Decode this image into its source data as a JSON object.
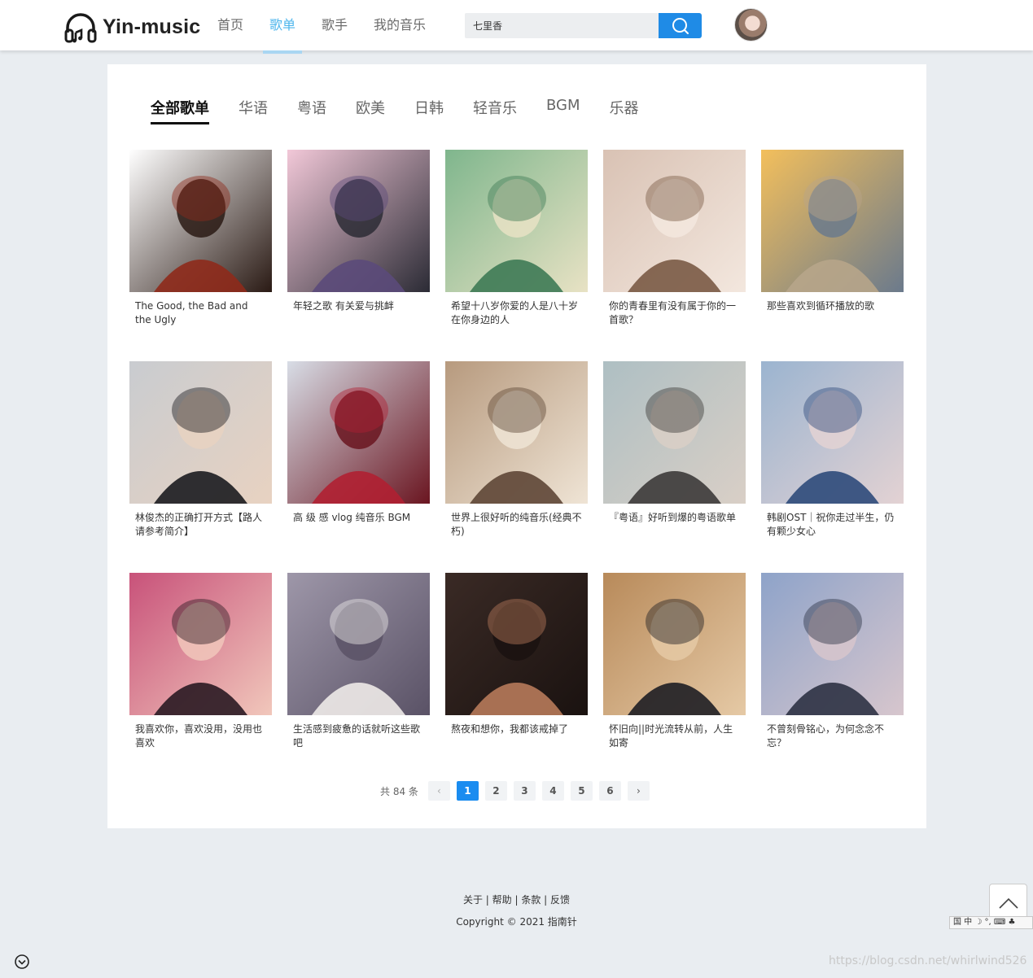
{
  "header": {
    "logo_text": "Yin-music",
    "nav": [
      "首页",
      "歌单",
      "歌手",
      "我的音乐"
    ],
    "active_nav": 1,
    "search_value": "七里香"
  },
  "tabs": [
    "全部歌单",
    "华语",
    "粤语",
    "欧美",
    "日韩",
    "轻音乐",
    "BGM",
    "乐器"
  ],
  "active_tab": 0,
  "playlists": [
    {
      "title": "The Good, the Bad and the Ugly",
      "palette": [
        "#ffffff",
        "#8e2a1b",
        "#2a1a14"
      ]
    },
    {
      "title": "年轻之歌 有关爱与挑衅",
      "palette": [
        "#f2c8d8",
        "#5b4a7a",
        "#2b2b35"
      ]
    },
    {
      "title": "希望十八岁你爱的人是八十岁在你身边的人",
      "palette": [
        "#7fb68d",
        "#3e7a55",
        "#e8e2c4"
      ]
    },
    {
      "title": "你的青春里有没有属于你的一首歌？",
      "palette": [
        "#d9c2b4",
        "#7a5a45",
        "#f3e7de"
      ]
    },
    {
      "title": "那些喜欢到循环播放的歌",
      "palette": [
        "#f3bf5c",
        "#b7a58a",
        "#6b7a8c"
      ]
    },
    {
      "title": "林俊杰的正确打开方式【路人请参考简介】",
      "palette": [
        "#c9ccd0",
        "#1b1b1f",
        "#e8d2c1"
      ]
    },
    {
      "title": "高 级 感 vlog 纯音乐 BGM",
      "palette": [
        "#d8dde6",
        "#b02032",
        "#6a1520"
      ]
    },
    {
      "title": "世界上很好听的纯音乐(经典不朽)",
      "palette": [
        "#b79a7e",
        "#5e4636",
        "#efe4d5"
      ]
    },
    {
      "title": "『粤语』好听到爆的粤语歌单",
      "palette": [
        "#aebfc3",
        "#3c3a38",
        "#d9cfc6"
      ]
    },
    {
      "title": "韩剧OST｜祝你走过半生，仍有颗少女心",
      "palette": [
        "#9bb4d0",
        "#2e4a7a",
        "#e3d2d3"
      ]
    },
    {
      "title": "我喜欢你，喜欢没用，没用也喜欢",
      "palette": [
        "#c8527a",
        "#2a1a22",
        "#f1c7bb"
      ]
    },
    {
      "title": "生活感到疲惫的话就听这些歌吧",
      "palette": [
        "#9e97a9",
        "#eeeae8",
        "#5a5266"
      ]
    },
    {
      "title": "熬夜和想你，我都该戒掉了",
      "palette": [
        "#3a2a25",
        "#b77a5a",
        "#1a1210"
      ]
    },
    {
      "title": "怀旧向||时光流转从前，人生如寄",
      "palette": [
        "#b88a5a",
        "#1e1e24",
        "#e5c9a5"
      ]
    },
    {
      "title": "不曾刻骨铭心，为何念念不忘？",
      "palette": [
        "#8ea3c9",
        "#2d3244",
        "#d7c6cd"
      ]
    }
  ],
  "pagination": {
    "total_label": "共 84 条",
    "pages": [
      "1",
      "2",
      "3",
      "4",
      "5",
      "6"
    ],
    "current": 1,
    "prev": "‹",
    "next": "›"
  },
  "footer": {
    "links": "关于 | 帮助 | 条款 | 反馈",
    "copyright": "Copyright © 2021 指南针"
  },
  "ime_bar": "国 中 ☽ °, ⌨ ♣",
  "watermark": "https://blog.csdn.net/whirlwind526"
}
